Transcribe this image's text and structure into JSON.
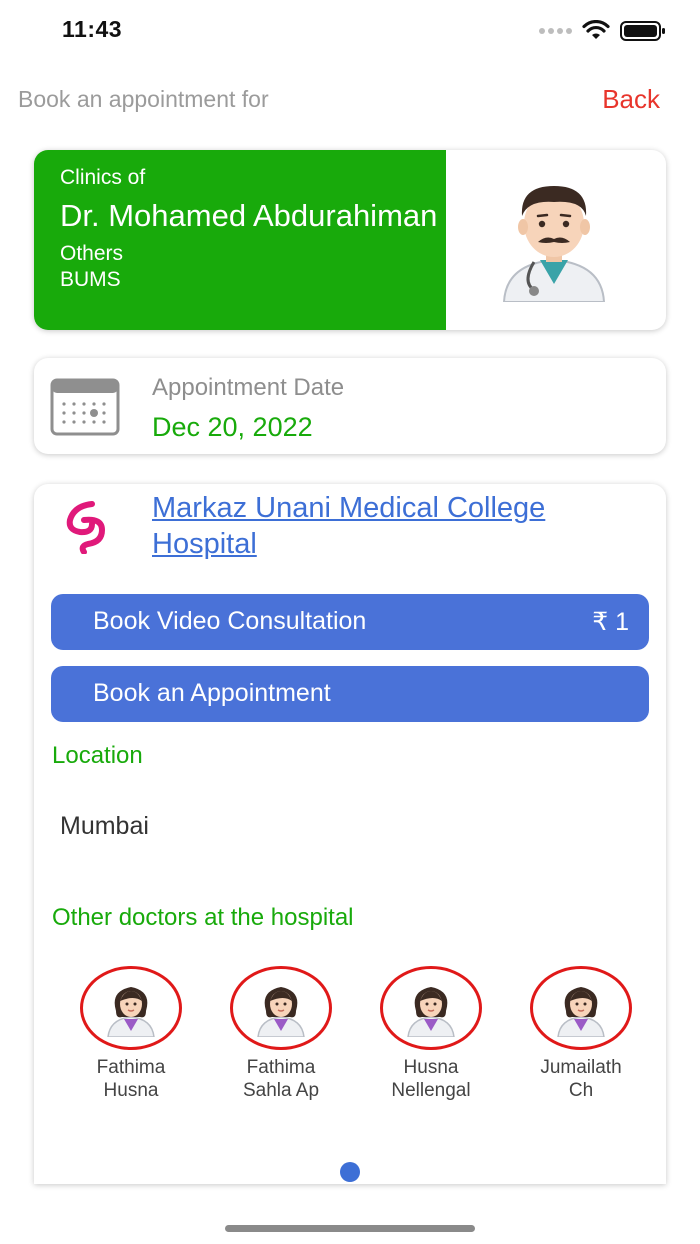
{
  "status_bar": {
    "time": "11:43"
  },
  "nav": {
    "title": "Book an appointment for",
    "back_label": "Back"
  },
  "doctor": {
    "clinics_of": "Clinics of",
    "name": "Dr. Mohamed Abdurahiman",
    "specialty": "Others",
    "degree": "BUMS",
    "avatar_icon": "male-doctor-icon"
  },
  "appointment": {
    "date_label": "Appointment Date",
    "date_value": "Dec 20, 2022",
    "calendar_icon": "calendar-icon"
  },
  "hospital": {
    "name": "Markaz Unani Medical College Hospital",
    "logo_icon": "hospital-logo-icon",
    "video_button_label": "Book Video Consultation",
    "video_price": "₹ 1",
    "appointment_button_label": "Book an Appointment",
    "location_label": "Location",
    "location_value": "Mumbai",
    "other_doctors_label": "Other doctors at the hospital",
    "other_doctors": [
      {
        "first": "Fathima",
        "last": "Husna"
      },
      {
        "first": "Fathima",
        "last": "Sahla Ap"
      },
      {
        "first": "Husna",
        "last": "Nellengal"
      },
      {
        "first": "Jumailath",
        "last": "Ch"
      }
    ]
  },
  "colors": {
    "accent_green": "#18aa0b",
    "button_blue": "#4a72d8",
    "link_blue": "#3d6fd6",
    "back_red": "#e8352c",
    "avatar_ring_red": "#e01919"
  }
}
